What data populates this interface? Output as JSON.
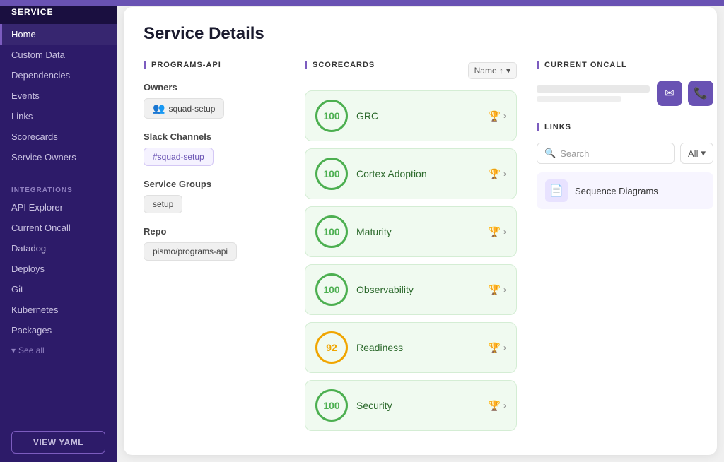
{
  "sidebar": {
    "header": "SERVICE",
    "items": [
      {
        "label": "Home",
        "active": true
      },
      {
        "label": "Custom Data",
        "active": false
      },
      {
        "label": "Dependencies",
        "active": false
      },
      {
        "label": "Events",
        "active": false
      },
      {
        "label": "Links",
        "active": false
      },
      {
        "label": "Scorecards",
        "active": false
      },
      {
        "label": "Service Owners",
        "active": false
      }
    ],
    "integrations_label": "INTEGRATIONS",
    "integration_items": [
      {
        "label": "API Explorer"
      },
      {
        "label": "Current Oncall"
      },
      {
        "label": "Datadog"
      },
      {
        "label": "Deploys"
      },
      {
        "label": "Git"
      },
      {
        "label": "Kubernetes"
      },
      {
        "label": "Packages"
      }
    ],
    "see_all": "See all",
    "view_yaml": "VIEW YAML"
  },
  "main": {
    "title": "Service Details",
    "programs_api": {
      "section_title": "PROGRAMS-API",
      "owners_label": "Owners",
      "owner_chip": "squad-setup",
      "slack_label": "Slack Channels",
      "slack_channel": "#squad-setup",
      "groups_label": "Service Groups",
      "group_chip": "setup",
      "repo_label": "Repo",
      "repo_value": "pismo/programs-api"
    },
    "scorecards": {
      "section_title": "SCORECARDS",
      "sort_label": "Name ↑",
      "items": [
        {
          "name": "GRC",
          "score": 100,
          "trophy": "gold",
          "amber": false
        },
        {
          "name": "Cortex Adoption",
          "score": 100,
          "trophy": "silver",
          "amber": false
        },
        {
          "name": "Maturity",
          "score": 100,
          "trophy": "gold",
          "amber": false
        },
        {
          "name": "Observability",
          "score": 100,
          "trophy": "gold",
          "amber": false
        },
        {
          "name": "Readiness",
          "score": 92,
          "trophy": "gold",
          "amber": true
        },
        {
          "name": "Security",
          "score": 100,
          "trophy": "gold",
          "amber": false
        }
      ]
    },
    "oncall": {
      "section_title": "CURRENT ONCALL",
      "name_placeholder": "",
      "email_placeholder": ""
    },
    "links": {
      "section_title": "LINKS",
      "search_placeholder": "Search",
      "filter_label": "All",
      "items": [
        {
          "name": "Sequence Diagrams",
          "icon": "📄"
        }
      ]
    }
  }
}
